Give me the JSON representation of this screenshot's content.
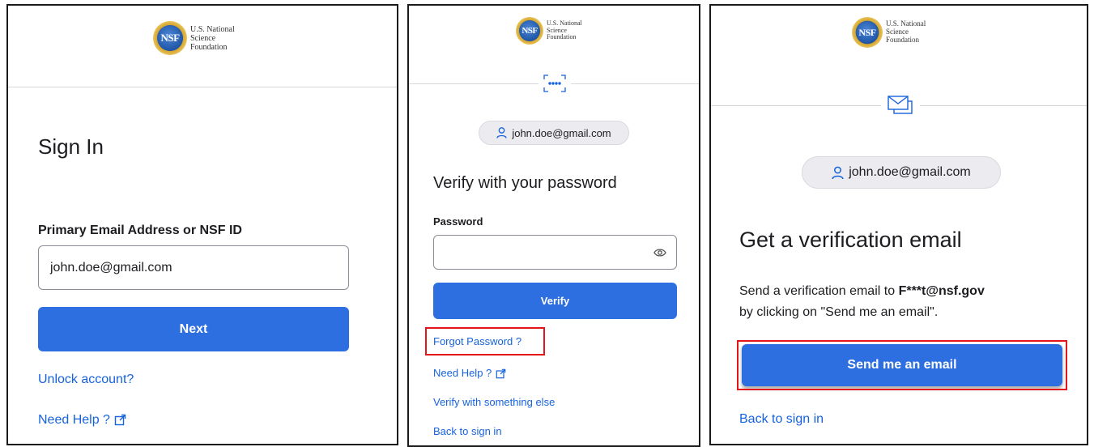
{
  "brand": {
    "seal_text": "NSF",
    "name_line1": "U.S. National",
    "name_line2": "Science",
    "name_line3": "Foundation"
  },
  "sign_in": {
    "title": "Sign In",
    "field_label": "Primary Email Address or NSF ID",
    "field_value": "john.doe@gmail.com",
    "next_button": "Next",
    "unlock_link": "Unlock account?",
    "help_link": "Need Help ?"
  },
  "verify_password": {
    "divider_icon": "password-dots-icon",
    "user_chip": "john.doe@gmail.com",
    "title": "Verify with your password",
    "password_label": "Password",
    "password_value": "",
    "verify_button": "Verify",
    "forgot_link": "Forgot Password ?",
    "help_link": "Need Help ?",
    "other_method_link": "Verify with something else",
    "back_link": "Back to sign in"
  },
  "verify_email": {
    "divider_icon": "envelope-icon",
    "user_chip": "john.doe@gmail.com",
    "title": "Get a verification email",
    "body_prefix": "Send a verification email to",
    "masked_email": "F***t@nsf.gov",
    "body_suffix": "by clicking on \"Send me an email\".",
    "send_button": "Send me an email",
    "back_link": "Back to sign in"
  },
  "colors": {
    "primary": "#2d6fe0",
    "link": "#1662dd",
    "highlight": "#e3171b",
    "chip_bg": "#ececf0",
    "divider": "#d7d7dc"
  }
}
